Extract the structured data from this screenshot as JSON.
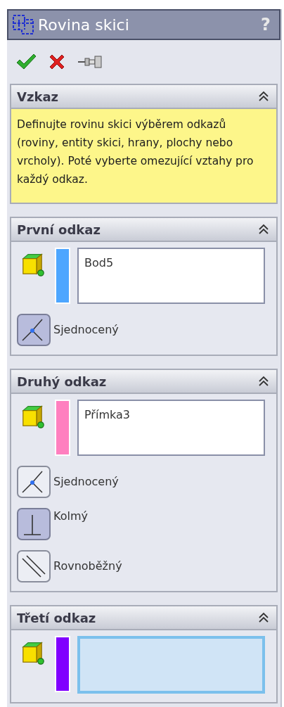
{
  "window": {
    "title": "Rovina skici",
    "help": "?"
  },
  "toolbar": [
    {
      "kind": "ok"
    },
    {
      "kind": "cancel"
    },
    {
      "kind": "pin"
    }
  ],
  "message": {
    "title": "Vzkaz",
    "expanded": true,
    "text": "Definujte rovinu skici výběrem odkazů (roviny, entity skici, hrany, plochy nebo vrcholy). Poté vyberte omezující vztahy pro každý odkaz."
  },
  "references": [
    {
      "title": "První odkaz",
      "expanded": true,
      "color": "#4da6ff",
      "value": "Bod5",
      "focused": false,
      "relations": [
        {
          "kind": "coincident",
          "label": "Sjednocený",
          "selected": true
        }
      ]
    },
    {
      "title": "Druhý odkaz",
      "expanded": true,
      "color": "#ff7fbf",
      "value": "Přímka3",
      "focused": false,
      "relations": [
        {
          "kind": "coincident",
          "label": "Sjednocený",
          "selected": false
        },
        {
          "kind": "perpendicular",
          "label": "Kolmý",
          "selected": true
        },
        {
          "kind": "parallel",
          "label": "Rovnoběžný",
          "selected": false
        }
      ]
    },
    {
      "title": "Třetí odkaz",
      "expanded": true,
      "color": "#8000ff",
      "focused": true
    }
  ]
}
